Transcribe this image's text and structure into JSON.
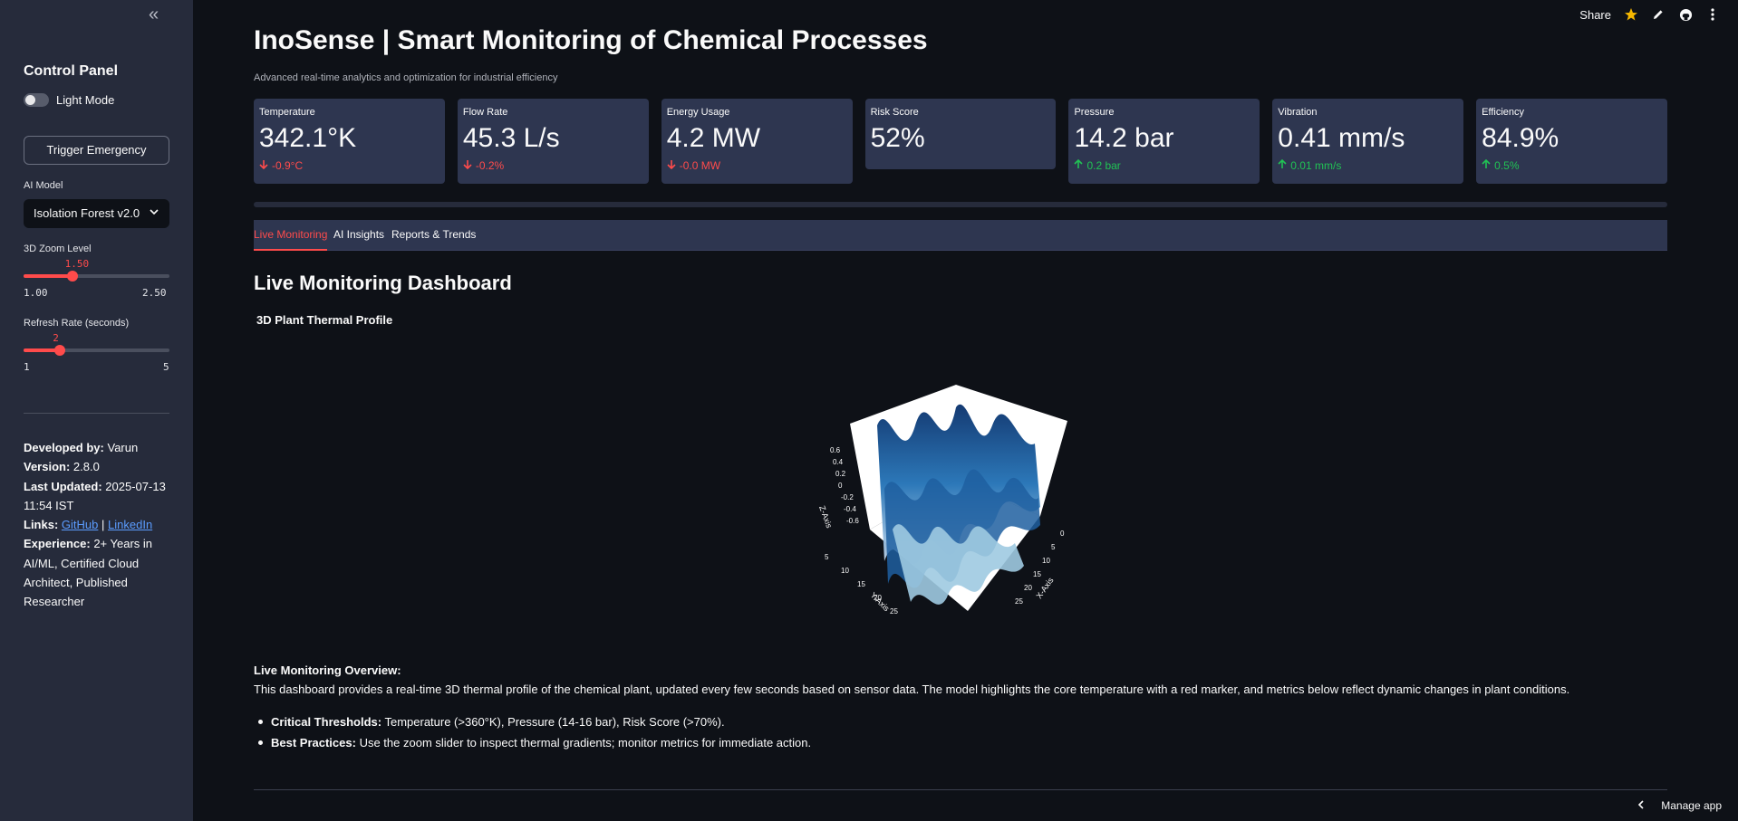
{
  "sidebar": {
    "collapse_glyph": "«",
    "title": "Control Panel",
    "light_mode_label": "Light Mode",
    "light_mode_on": false,
    "emergency_label": "Trigger Emergency",
    "ai_model_label": "AI Model",
    "ai_model_value": "Isolation Forest v2.0",
    "zoom": {
      "label": "3D Zoom Level",
      "value": "1.50",
      "min": "1.00",
      "max": "2.50",
      "fraction": 0.333
    },
    "refresh": {
      "label": "Refresh Rate (seconds)",
      "value": "2",
      "min": "1",
      "max": "5",
      "fraction": 0.25
    },
    "developed_by_label": "Developed by:",
    "developed_by": "Varun",
    "version_label": "Version:",
    "version": "2.8.0",
    "updated_label": "Last Updated:",
    "updated": "2025-07-13 11:54 IST",
    "links_label": "Links:",
    "link_github": "GitHub",
    "link_sep": "|",
    "link_linkedin": "LinkedIn",
    "experience_label": "Experience:",
    "experience": "2+ Years in AI/ML, Certified Cloud Architect, Published Researcher"
  },
  "toolbar": {
    "share": "Share",
    "icons": [
      "star-icon",
      "edit-icon",
      "github-icon",
      "more-icon"
    ]
  },
  "header": {
    "title": "InoSense | Smart Monitoring of Chemical Processes",
    "subtitle": "Advanced real-time analytics and optimization for industrial efficiency"
  },
  "metrics": [
    {
      "label": "Temperature",
      "value": "342.1°K",
      "delta": "-0.9°C",
      "dir": "down"
    },
    {
      "label": "Flow Rate",
      "value": "45.3 L/s",
      "delta": "-0.2%",
      "dir": "down"
    },
    {
      "label": "Energy Usage",
      "value": "4.2 MW",
      "delta": "-0.0 MW",
      "dir": "down"
    },
    {
      "label": "Risk Score",
      "value": "52%",
      "delta": "",
      "dir": "none"
    },
    {
      "label": "Pressure",
      "value": "14.2 bar",
      "delta": "0.2 bar",
      "dir": "up"
    },
    {
      "label": "Vibration",
      "value": "0.41 mm/s",
      "delta": "0.01 mm/s",
      "dir": "up"
    },
    {
      "label": "Efficiency",
      "value": "84.9%",
      "delta": "0.5%",
      "dir": "up"
    }
  ],
  "progress_fraction": 0.0,
  "tabs": [
    {
      "label": "Live Monitoring",
      "active": true
    },
    {
      "label": "AI Insights",
      "active": false
    },
    {
      "label": "Reports & Trends",
      "active": false
    }
  ],
  "main": {
    "section_title": "Live Monitoring Dashboard",
    "chart_title": "3D Plant Thermal Profile",
    "overview_heading": "Live Monitoring Overview:",
    "overview_text": "This dashboard provides a real-time 3D thermal profile of the chemical plant, updated every few seconds based on sensor data. The model highlights the core temperature with a red marker, and metrics below reflect dynamic changes in plant conditions.",
    "bullets": [
      {
        "bold": "Critical Thresholds:",
        "text": "Temperature (>360°K), Pressure (14-16 bar), Risk Score (>70%)."
      },
      {
        "bold": "Best Practices:",
        "text": "Use the zoom slider to inspect thermal gradients; monitor metrics for immediate action."
      }
    ]
  },
  "chart_data": {
    "type": "surface",
    "title": "",
    "xlabel": "X-Axis",
    "ylabel": "Y-Axis",
    "zlabel": "Z-Axis",
    "x_ticks": [
      "0",
      "5",
      "10",
      "15",
      "20",
      "25"
    ],
    "y_ticks": [
      "5",
      "10",
      "15",
      "20",
      "25"
    ],
    "z_ticks": [
      "0.6",
      "0.4",
      "0.2",
      "0",
      "-0.2",
      "-0.4",
      "-0.6"
    ],
    "colorscale": [
      "#08306b",
      "#2171b5",
      "#9ecae1",
      "#deebf7"
    ]
  },
  "manage_app": "Manage app"
}
